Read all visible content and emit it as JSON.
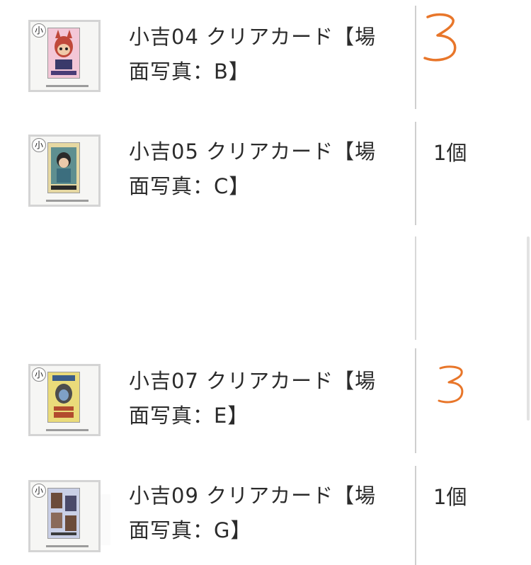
{
  "items": [
    {
      "name_line1": "小吉04 クリアカード【場",
      "name_line2": "面写真：B】",
      "quantity_handwritten": "3",
      "quantity": "",
      "thumb_badge": "小",
      "thumb_colors": {
        "card": "#f3c7d7",
        "accent": "#c0483a",
        "strip": "#4a3d77"
      }
    },
    {
      "name_line1": "小吉05 クリアカード【場",
      "name_line2": "面写真：C】",
      "quantity_handwritten": "",
      "quantity": "1個",
      "thumb_badge": "小",
      "thumb_colors": {
        "card": "#e6d8a2",
        "accent": "#3c6e7e",
        "strip": "#2a2a2a"
      }
    },
    {
      "name_line1": "",
      "name_line2": "",
      "quantity_handwritten": "",
      "quantity": "",
      "thumb_badge": "",
      "thumb_colors": {
        "card": "#fafafa",
        "accent": "#fafafa",
        "strip": "#fafafa"
      }
    },
    {
      "name_line1": "小吉07 クリアカード【場",
      "name_line2": "面写真：E】",
      "quantity_handwritten": "3",
      "quantity": "",
      "thumb_badge": "小",
      "thumb_colors": {
        "card": "#eadb7a",
        "accent": "#3b5d8a",
        "strip": "#b24b2e"
      }
    },
    {
      "name_line1": "小吉09 クリアカード【場",
      "name_line2": "面写真：G】",
      "quantity_handwritten": "",
      "quantity": "1個",
      "thumb_badge": "小",
      "thumb_colors": {
        "card": "#c9cfe6",
        "accent": "#6b4b3a",
        "strip": "#3b3b3b"
      }
    }
  ],
  "colors": {
    "text": "#2b2b2b",
    "divider": "#cfcfcf",
    "handwriting": "#e8762a"
  }
}
